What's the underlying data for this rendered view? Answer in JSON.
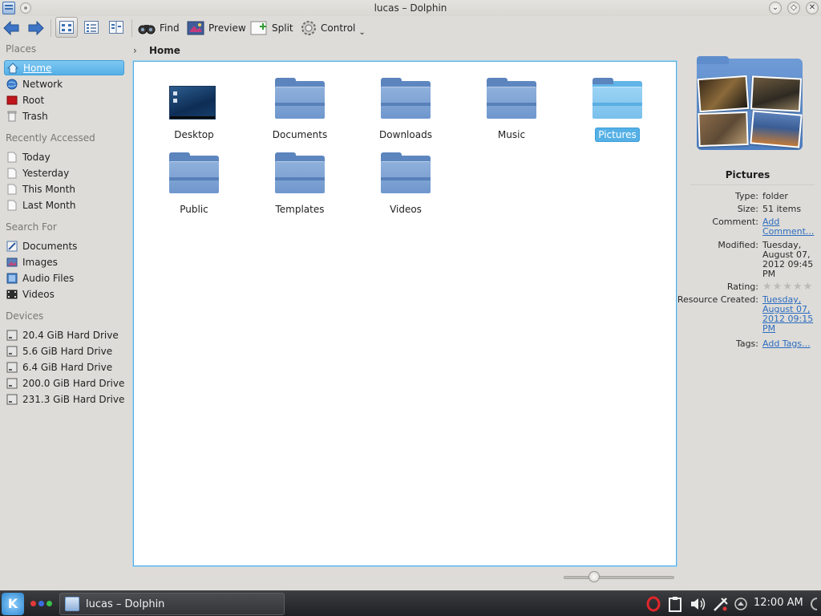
{
  "window": {
    "title": "lucas – Dolphin"
  },
  "toolbar": {
    "find_label": "Find",
    "preview_label": "Preview",
    "split_label": "Split",
    "control_label": "Control"
  },
  "places": {
    "sections": [
      {
        "title": "Places",
        "items": [
          {
            "label": "Home",
            "icon": "home-icon",
            "selected": true
          },
          {
            "label": "Network",
            "icon": "network-icon"
          },
          {
            "label": "Root",
            "icon": "root-folder-icon"
          },
          {
            "label": "Trash",
            "icon": "trash-icon"
          }
        ]
      },
      {
        "title": "Recently Accessed",
        "items": [
          {
            "label": "Today",
            "icon": "document-icon"
          },
          {
            "label": "Yesterday",
            "icon": "document-icon"
          },
          {
            "label": "This Month",
            "icon": "document-icon"
          },
          {
            "label": "Last Month",
            "icon": "document-icon"
          }
        ]
      },
      {
        "title": "Search For",
        "items": [
          {
            "label": "Documents",
            "icon": "documents-search-icon"
          },
          {
            "label": "Images",
            "icon": "images-search-icon"
          },
          {
            "label": "Audio Files",
            "icon": "audio-search-icon"
          },
          {
            "label": "Videos",
            "icon": "videos-search-icon"
          }
        ]
      },
      {
        "title": "Devices",
        "items": [
          {
            "label": "20.4 GiB Hard Drive",
            "icon": "hard-drive-icon"
          },
          {
            "label": "5.6 GiB Hard Drive",
            "icon": "hard-drive-icon"
          },
          {
            "label": "6.4 GiB Hard Drive",
            "icon": "hard-drive-icon"
          },
          {
            "label": "200.0 GiB Hard Drive",
            "icon": "hard-drive-icon"
          },
          {
            "label": "231.3 GiB Hard Drive",
            "icon": "hard-drive-icon"
          }
        ]
      }
    ]
  },
  "breadcrumb": {
    "current": "Home"
  },
  "files": [
    {
      "name": "Desktop",
      "type": "desktop"
    },
    {
      "name": "Documents",
      "type": "folder"
    },
    {
      "name": "Downloads",
      "type": "folder"
    },
    {
      "name": "Music",
      "type": "folder"
    },
    {
      "name": "Pictures",
      "type": "folder",
      "selected": true
    },
    {
      "name": "Public",
      "type": "folder"
    },
    {
      "name": "Templates",
      "type": "folder"
    },
    {
      "name": "Videos",
      "type": "folder"
    }
  ],
  "info": {
    "title": "Pictures",
    "type_key": "Type:",
    "type_val": "folder",
    "size_key": "Size:",
    "size_val": "51 items",
    "comment_key": "Comment:",
    "comment_val": "Add Comment...",
    "modified_key": "Modified:",
    "modified_val": "Tuesday, August 07, 2012 09:45 PM",
    "rating_key": "Rating:",
    "rating_val": 0,
    "rating_max": 5,
    "created_key": "Resource Created:",
    "created_val": "Tuesday, August 07, 2012 09:15 PM",
    "tags_key": "Tags:",
    "tags_val": "Add Tags..."
  },
  "zoom": {
    "level": 0.25
  },
  "taskbar": {
    "task_title": "lucas – Dolphin",
    "clock": "12:00 AM"
  },
  "colors": {
    "selection": "#55b0e6",
    "folder": "#6f97cd",
    "link": "#2b6cc0"
  }
}
